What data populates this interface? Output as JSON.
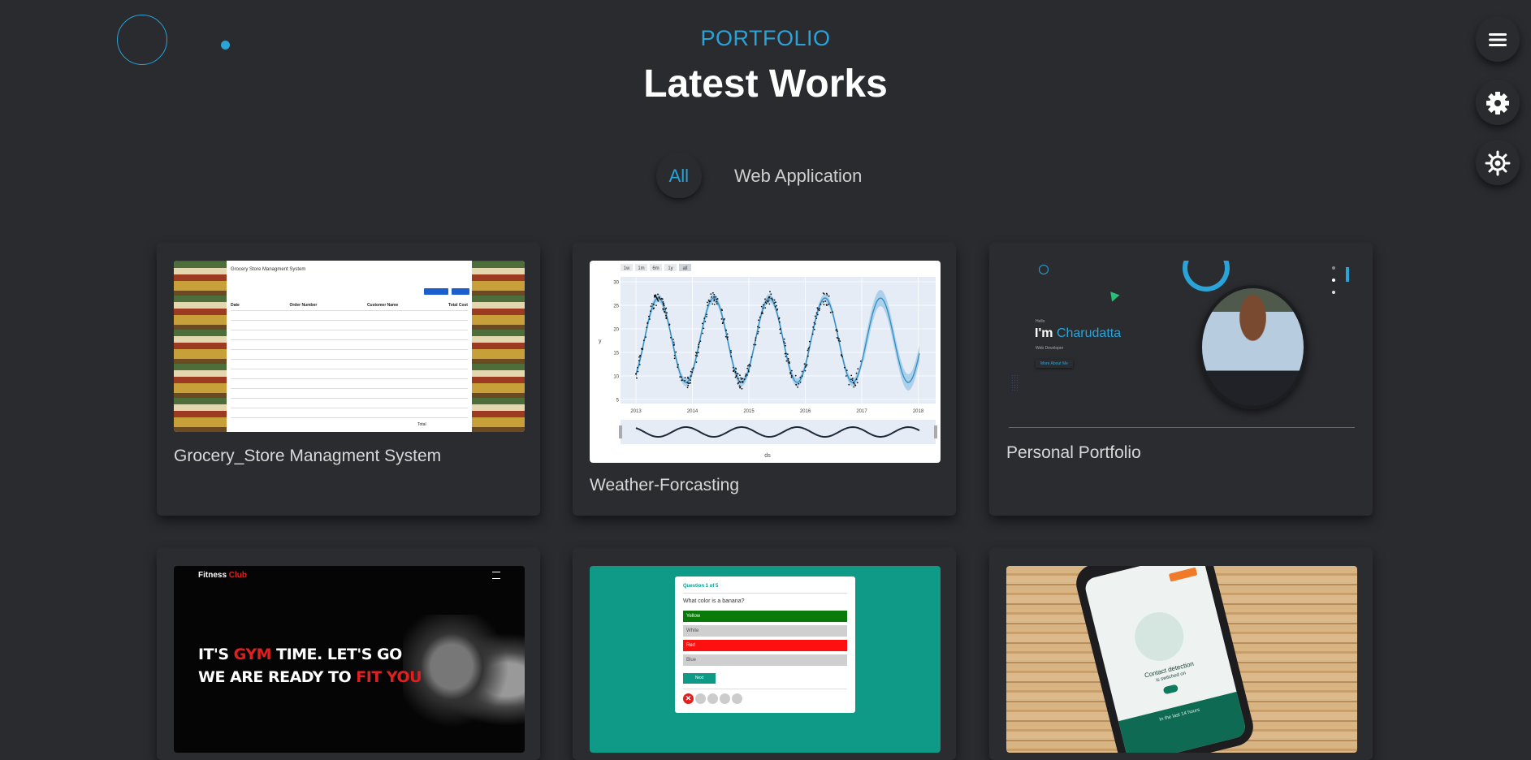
{
  "header": {
    "eyebrow": "PORTFOLIO",
    "title": "Latest Works"
  },
  "filters": [
    {
      "label": "All",
      "active": true
    },
    {
      "label": "Web Application",
      "active": false
    }
  ],
  "side_buttons": [
    "menu-icon",
    "gear-icon",
    "sun-icon"
  ],
  "colors": {
    "accent": "#2aa3d8",
    "background": "#2a2b2f"
  },
  "projects": [
    {
      "title": "Grocery_Store Managment System",
      "thumb": {
        "app_title": "Grocery Store Managment System",
        "buttons": [
          "Manage Product",
          "New Order"
        ],
        "columns": [
          "Date",
          "Order Number",
          "Customer Name",
          "Total Cost"
        ],
        "total_label": "Total"
      }
    },
    {
      "title": "Weather-Forcasting",
      "thumb": {
        "range_buttons": [
          "1w",
          "1m",
          "6m",
          "1y",
          "all"
        ],
        "x_ticks": [
          "2013",
          "2014",
          "2015",
          "2016",
          "2017",
          "2018"
        ],
        "y_ticks": [
          "30",
          "25",
          "20",
          "15",
          "10",
          "5"
        ],
        "ylabel": "y",
        "xlabel": "ds"
      }
    },
    {
      "title": "Personal Portfolio",
      "thumb": {
        "hello": "Hello",
        "im": "I'm",
        "name": "Charudatta",
        "role": "Web Developer",
        "button": "More About Me"
      }
    },
    {
      "title": "",
      "thumb": {
        "brand_a": "Fitness",
        "brand_b": "Club",
        "line1_a": "IT'S ",
        "line1_b": "GYM",
        "line1_c": " TIME. LET'S GO",
        "line2_a": "WE ARE READY TO ",
        "line2_b": "FIT YOU"
      }
    },
    {
      "title": "",
      "thumb": {
        "progress": "Question 1 of 5",
        "question": "What color is a banana?",
        "options": [
          "Yellow",
          "White",
          "Red",
          "Blue"
        ],
        "next": "Next"
      }
    },
    {
      "title": "",
      "thumb": {
        "headline": "Contact detection",
        "subline": "is switched on",
        "footer": "In the last 14 hours"
      }
    }
  ]
}
